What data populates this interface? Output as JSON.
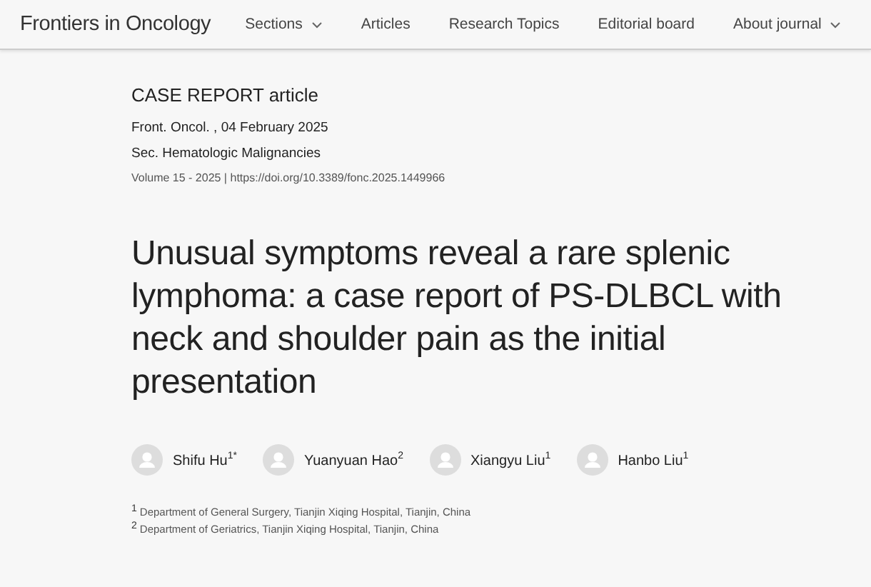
{
  "header": {
    "journal": "Frontiers in Oncology",
    "nav": [
      {
        "label": "Sections",
        "dropdown": true
      },
      {
        "label": "Articles",
        "dropdown": false
      },
      {
        "label": "Research Topics",
        "dropdown": false
      },
      {
        "label": "Editorial board",
        "dropdown": false
      },
      {
        "label": "About journal",
        "dropdown": true
      }
    ]
  },
  "article": {
    "type": "CASE REPORT article",
    "journal_date": "Front. Oncol. , 04 February 2025",
    "section": "Sec. Hematologic Malignancies",
    "volume": "Volume 15 - 2025 |",
    "doi": "https://doi.org/10.3389/fonc.2025.1449966",
    "title": "Unusual symptoms reveal a rare splenic lymphoma: a case report of PS-DLBCL with neck and shoulder pain as the initial presentation",
    "authors": [
      {
        "name": "Shifu Hu$^{1*}$"
      },
      {
        "name": "Yuanyuan Hao$^{2}$"
      },
      {
        "name": "Xiangyu Liu$^{1}$"
      },
      {
        "name": "Hanbo Liu$^{1}$"
      }
    ],
    "affiliations": [
      {
        "number": "1",
        "text": "Department of General Surgery, Tianjin Xiqing Hospital, Tianjin, China"
      },
      {
        "number": "2",
        "text": "Department of Geriatrics, Tianjin Xiqing Hospital, Tianjin, China"
      }
    ]
  }
}
